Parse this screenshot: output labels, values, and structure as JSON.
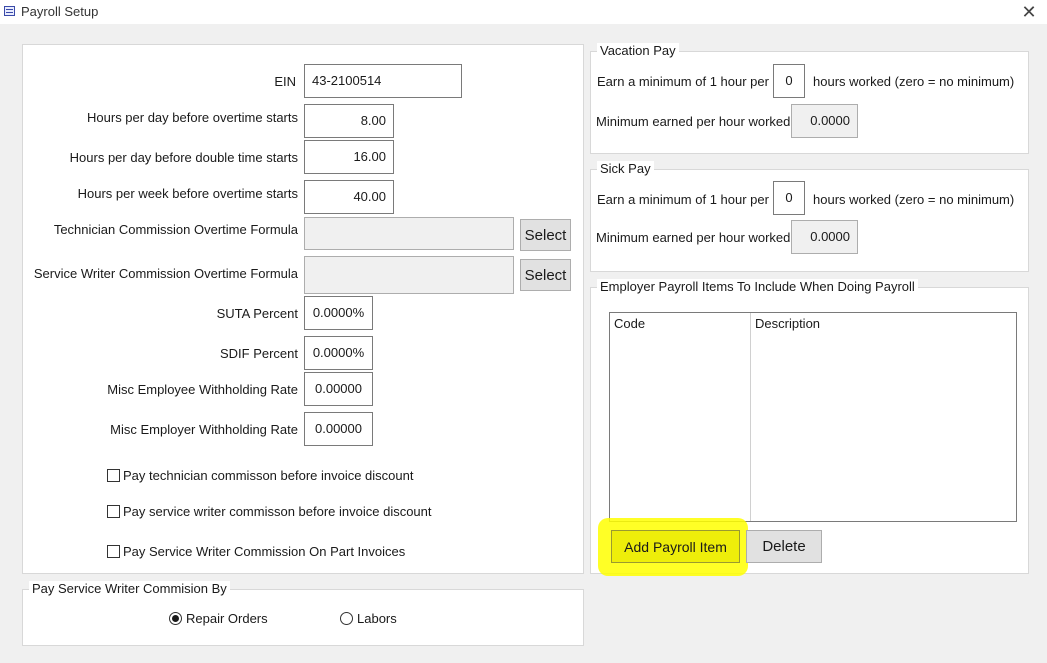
{
  "window": {
    "title": "Payroll Setup",
    "close": "✕"
  },
  "main_form": {
    "ein_label": "EIN",
    "ein_value": "43-2100514",
    "hours_day_ot_label": "Hours per day before overtime starts",
    "hours_day_ot_value": "8.00",
    "hours_day_dt_label": "Hours per day before double time starts",
    "hours_day_dt_value": "16.00",
    "hours_week_ot_label": "Hours per week before overtime starts",
    "hours_week_ot_value": "40.00",
    "tech_formula_label": "Technician Commission Overtime Formula",
    "tech_formula_value": "",
    "sw_formula_label": "Service Writer Commission Overtime Formula",
    "sw_formula_value": "",
    "select_label": "Select",
    "suta_label": "SUTA Percent",
    "suta_value": "0.0000%",
    "sdif_label": "SDIF Percent",
    "sdif_value": "0.0000%",
    "misc_emp_label": "Misc Employee Withholding Rate",
    "misc_emp_value": "0.00000",
    "misc_employer_label": "Misc Employer Withholding Rate",
    "misc_employer_value": "0.00000",
    "check_tech_label": "Pay technician commisson before invoice discount",
    "check_sw_label": "Pay service writer commisson before invoice discount",
    "check_part_label": "Pay Service Writer Commission On Part Invoices"
  },
  "commission_by": {
    "title": "Pay Service Writer Commision By",
    "option_repair": "Repair Orders",
    "option_labors": "Labors",
    "selected": "Repair Orders"
  },
  "vacation": {
    "title": "Vacation Pay",
    "earn_label": "Earn a minimum of 1 hour per",
    "earn_value": "0",
    "hours_label": "hours worked  (zero = no minimum)",
    "min_label": "Minimum earned per hour worked",
    "min_value": "0.0000"
  },
  "sick": {
    "title": "Sick Pay",
    "earn_label": "Earn a minimum of 1 hour per",
    "earn_value": "0",
    "hours_label": "hours worked  (zero = no minimum)",
    "min_label": "Minimum earned per hour worked",
    "min_value": "0.0000"
  },
  "employer_items": {
    "title": "Employer Payroll Items To Include When Doing Payroll",
    "columns": [
      "Code",
      "Description"
    ],
    "add_label": "Add Payroll Item",
    "delete_label": "Delete"
  },
  "colors": {
    "highlight": "#ffff00"
  }
}
